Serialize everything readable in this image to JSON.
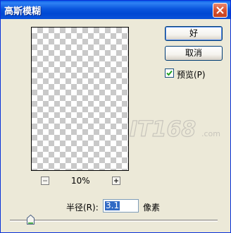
{
  "dialog": {
    "title": "高斯模糊",
    "buttons": {
      "ok": "好",
      "cancel": "取消"
    },
    "preview_checkbox": {
      "label": "预览(P)",
      "checked": true
    },
    "zoom": {
      "level": "10%",
      "zoom_out_icon": "minus-icon",
      "zoom_in_icon": "plus-icon"
    },
    "radius": {
      "label": "半径(R):",
      "value": "3.1",
      "unit": "像素",
      "slider_fraction": 0.1
    },
    "watermark": {
      "text": "IT168",
      "suffix": ".com"
    },
    "close_icon": "close-icon"
  },
  "colors": {
    "title_bar": "#0a56dd",
    "dialog_bg": "#ece9d8",
    "selection": "#316ac5",
    "close_button": "#d8512f"
  }
}
